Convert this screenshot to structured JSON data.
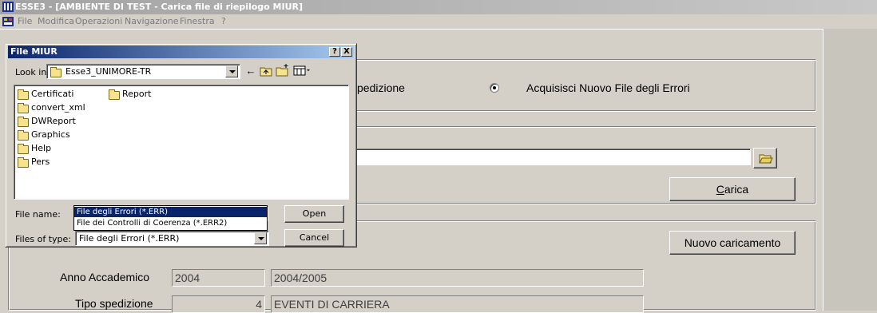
{
  "window": {
    "title": "ESSE3 - [AMBIENTE DI TEST - Carica file di riepilogo MIUR]"
  },
  "menu": {
    "items": [
      "File",
      "Modifica",
      "Operazioni",
      "Navigazione",
      "Finestra",
      "?"
    ]
  },
  "main": {
    "option_partial_label": "pedizione",
    "option_new_errors_label": "Acquisisci Nuovo File degli Errori",
    "option_new_errors_selected": true,
    "path_value": "",
    "carica_label": "Carica",
    "carica_accel": "C",
    "carica_rest": "arica",
    "nuovo_caricamento_label": "Nuovo caricamento",
    "anno_accademico_label": "Anno Accademico",
    "anno_accademico_code": "2004",
    "anno_accademico_desc": "2004/2005",
    "tipo_spedizione_label": "Tipo spedizione",
    "tipo_spedizione_code": "4",
    "tipo_spedizione_desc": "EVENTI DI CARRIERA"
  },
  "dialog": {
    "title": "File MIUR",
    "help_btn": "?",
    "close_btn": "X",
    "look_in_label": "Look in:",
    "look_in_value": "Esse3_UNIMORE-TR",
    "files": [
      "Certificati",
      "convert_xml",
      "DWReport",
      "Graphics",
      "Help",
      "Pers",
      "Report"
    ],
    "file_name_label": "File name:",
    "file_name_value": "",
    "files_of_type_label": "Files of type:",
    "files_of_type_value": "File degli Errori (*.ERR)",
    "type_options": [
      "File degli Errori (*.ERR)",
      "File dei Controlli di Coerenza (*.ERR2)"
    ],
    "open_label": "Open",
    "cancel_label": "Cancel"
  },
  "colors": {
    "face": "#d4d0c8",
    "dialog_title": "#0a246a",
    "selection": "#0a246a"
  }
}
